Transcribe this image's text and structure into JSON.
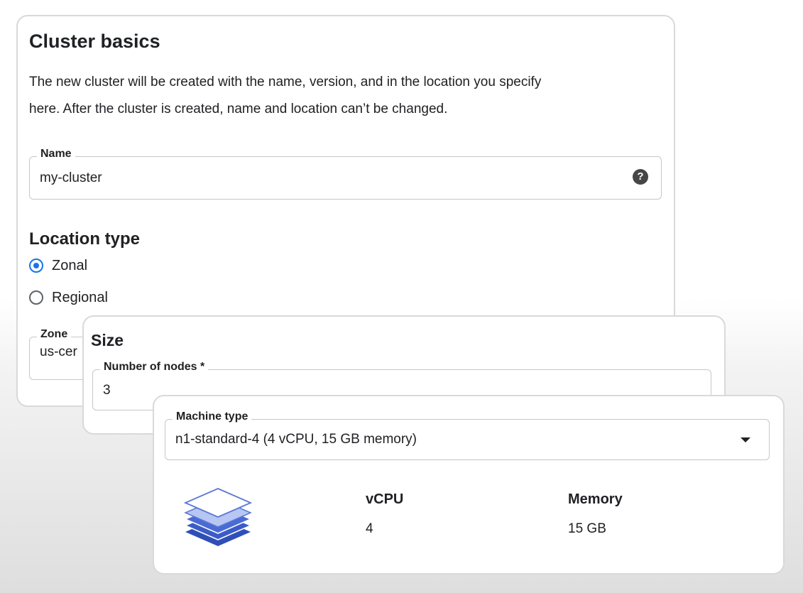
{
  "cluster_basics": {
    "title": "Cluster basics",
    "description_line1": "The new cluster will be created with the name, version, and in the location you specify",
    "description_line2": "here. After the cluster is created, name and location can’t be changed.",
    "name_field": {
      "label": "Name",
      "value": "my-cluster",
      "help_icon": "help-icon",
      "help_glyph": "?"
    },
    "location_type": {
      "title": "Location type",
      "options": [
        {
          "label": "Zonal",
          "selected": true
        },
        {
          "label": "Regional",
          "selected": false
        }
      ]
    },
    "zone_field": {
      "label": "Zone",
      "value": "us-cer"
    }
  },
  "size": {
    "title": "Size",
    "nodes_field": {
      "label": "Number of nodes *",
      "value": "3"
    }
  },
  "machine": {
    "type_field": {
      "label": "Machine type",
      "value": "n1-standard-4 (4 vCPU, 15 GB memory)",
      "icon": "dropdown-arrow-icon"
    },
    "stack_icon": "layers-stack-icon",
    "specs": {
      "vcpu_label": "vCPU",
      "vcpu_value": "4",
      "memory_label": "Memory",
      "memory_value": "15 GB"
    }
  },
  "colors": {
    "accent": "#1a73e8",
    "stack_dark": "#3c5bc5",
    "stack_light": "#c8d4f7",
    "border": "#d9d9d9"
  }
}
